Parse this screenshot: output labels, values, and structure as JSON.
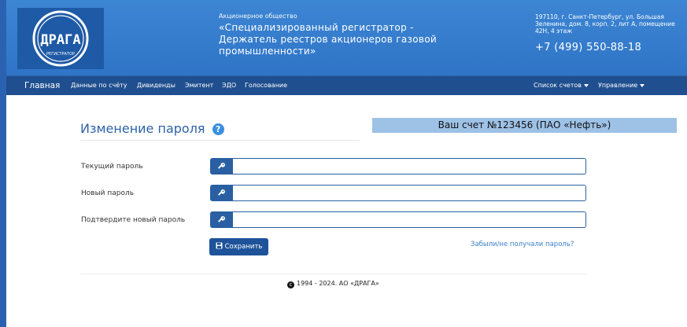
{
  "header": {
    "logo_text": "ДРАГА",
    "logo_subtext": "РЕГИСТРАТОР",
    "company_type": "Акционерное общество",
    "company_name": "«Специализированный регистратор - Держатель реестров акционеров газовой промышленности»",
    "address": "197110, г. Санкт-Петербург, ул. Большая Зеленина, дом. 8, корп. 2, лит А, помещение 42Н, 4 этаж",
    "phone": "+7 (499) 550-88-18"
  },
  "nav": {
    "home": "Главная",
    "account_data": "Данные по счёту",
    "dividends": "Дивиденды",
    "issuer": "Эмитент",
    "edo": "ЭДО",
    "voting": "Голосование",
    "accounts_list": "Список счетов",
    "management": "Управление"
  },
  "page": {
    "title": "Изменение пароля",
    "account_banner": "Ваш счет №123456 (ПАО «Нефть»)"
  },
  "form": {
    "current_password_label": "Текущий пароль",
    "new_password_label": "Новый пароль",
    "confirm_password_label": "Подтвердите новый пароль",
    "current_password_value": "",
    "new_password_value": "",
    "confirm_password_value": "",
    "save_label": "Сохранить",
    "forgot_link": "Забыли/не получали пароль?"
  },
  "footer": {
    "copyright": "1994 - 2024. АО «ДРАГА»"
  },
  "colors": {
    "header_bg": "#3d86d4",
    "nav_bg": "#1f4f8f",
    "accent": "#2a5fa3",
    "banner_bg": "#9ec1e6"
  },
  "icons": {
    "key": "key-icon",
    "help": "question-circle-icon",
    "save": "floppy-disk-icon",
    "copyright": "copyright-icon",
    "dropdown": "caret-down-icon"
  }
}
